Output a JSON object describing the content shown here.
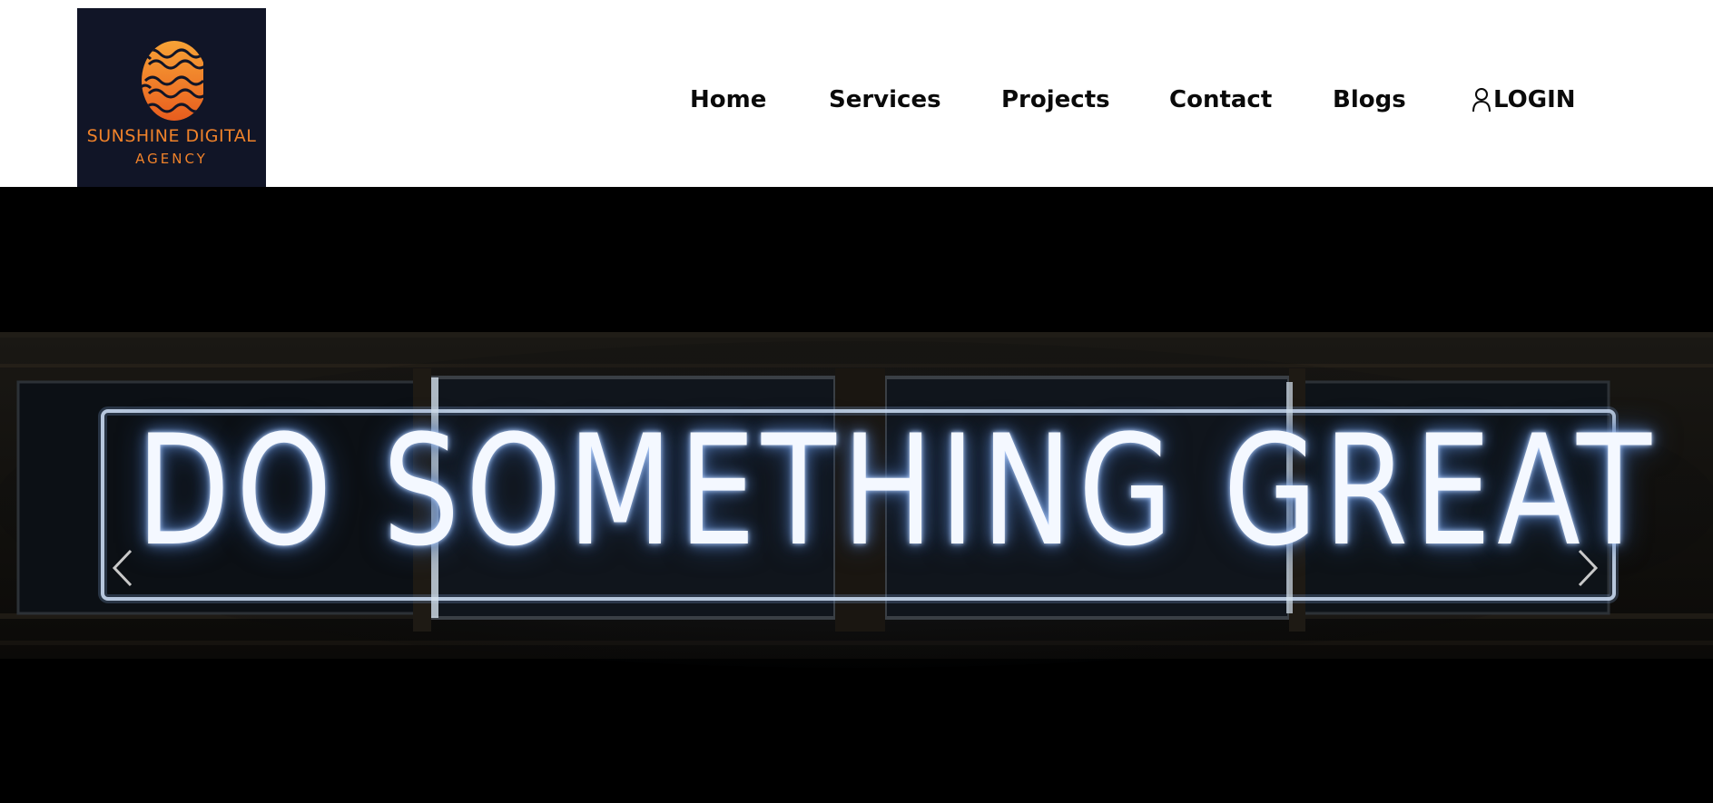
{
  "brand": {
    "name": "SUNSHINE DIGITAL",
    "subname": "AGENCY",
    "colors": {
      "logo_background": "#111527",
      "logo_text": "#f0822a",
      "logo_gradient_top": "#f7a336",
      "logo_gradient_bottom": "#e85d1e"
    }
  },
  "nav": {
    "items": [
      {
        "label": "Home"
      },
      {
        "label": "Services"
      },
      {
        "label": "Projects"
      },
      {
        "label": "Contact"
      },
      {
        "label": "Blogs"
      }
    ],
    "login_label": "LOGIN",
    "login_icon": "user-icon"
  },
  "hero": {
    "neon_text": "DO SOMETHING GREAT",
    "prev_icon": "chevron-left-icon",
    "next_icon": "chevron-right-icon"
  }
}
